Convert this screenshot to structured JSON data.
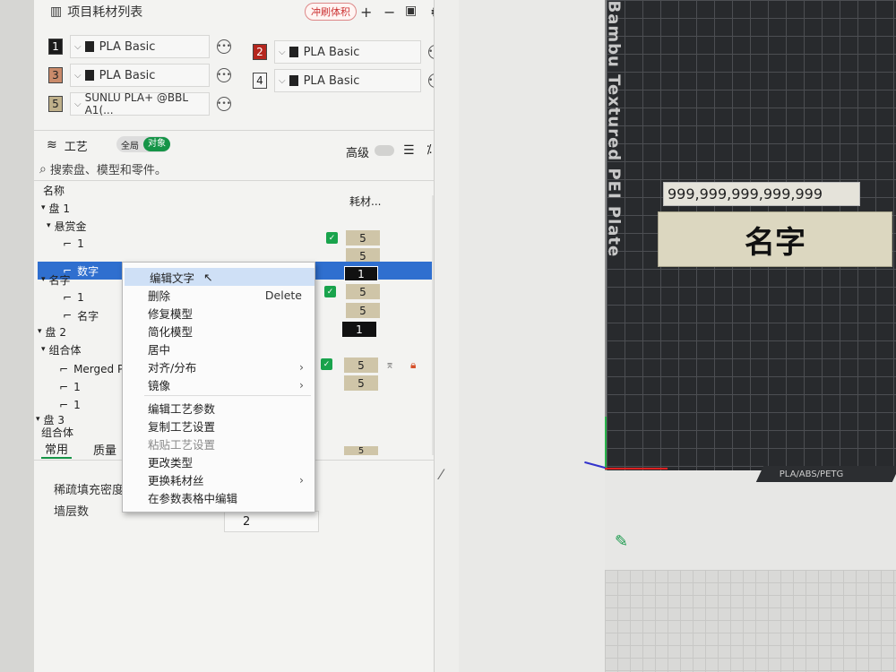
{
  "topbar": {
    "title": "项目耗材列表",
    "flush_button": "冲刷体积",
    "icons": [
      "plus-icon",
      "minus-icon",
      "sync-icon",
      "gear-icon"
    ]
  },
  "filaments": [
    {
      "num": "1",
      "name": "PLA Basic",
      "color": "#1a1a1a"
    },
    {
      "num": "2",
      "name": "PLA Basic",
      "color": "#b5261e"
    },
    {
      "num": "3",
      "name": "PLA Basic",
      "color": "#c98a6a"
    },
    {
      "num": "4",
      "name": "PLA Basic",
      "color": "#f5f5f5"
    },
    {
      "num": "5",
      "name": "SUNLU PLA+ @BBL A1(...",
      "color": "#bfb08a"
    }
  ],
  "process": {
    "label": "工艺",
    "toggle_global": "全局",
    "toggle_object": "对象",
    "advanced": "高级"
  },
  "search": {
    "placeholder": "搜索盘、模型和零件。"
  },
  "tree": {
    "col_name": "名称",
    "col_filament": "耗材...",
    "rows": [
      {
        "label": "盘 1",
        "indent": 0,
        "arrow": true
      },
      {
        "label": "悬赏金",
        "indent": 1,
        "arrow": true
      },
      {
        "label": "1",
        "indent": 2,
        "check": true,
        "filament": "5"
      },
      {
        "label": "数字",
        "indent": 2,
        "selected": true,
        "filament": "5"
      },
      {
        "label": "",
        "indent": 0,
        "filament": "1",
        "black": true
      },
      {
        "label": "名字",
        "indent": 1,
        "arrow": true,
        "check": true,
        "filament": "5"
      },
      {
        "label": "1",
        "indent": 2,
        "filament": "5"
      },
      {
        "label": "名字",
        "indent": 2,
        "filament": "1",
        "black": true
      },
      {
        "label": "盘 2",
        "indent": 0,
        "arrow": true
      },
      {
        "label": "组合体",
        "indent": 1,
        "arrow": true
      },
      {
        "label": "Merged P",
        "indent": 2,
        "check": true,
        "filament": "5"
      },
      {
        "label": "1",
        "indent": 2,
        "filament": "5"
      },
      {
        "label": "1",
        "indent": 2
      },
      {
        "label": "盘 3",
        "indent": 0,
        "arrow": true
      },
      {
        "label": "组合体",
        "indent": 1,
        "arrow": true,
        "check": true,
        "filament": "5"
      }
    ]
  },
  "tabs": {
    "common": "常用",
    "quality": "质量"
  },
  "params": {
    "infill_density": "稀疏填充密度",
    "wall_loops": "墙层数",
    "wall_loops_value": "2"
  },
  "context_menu": {
    "items": [
      {
        "label": "编辑文字",
        "highlight": true
      },
      {
        "label": "删除",
        "shortcut": "Delete"
      },
      {
        "label": "修复模型"
      },
      {
        "label": "简化模型"
      },
      {
        "label": "居中"
      },
      {
        "label": "对齐/分布",
        "submenu": true
      },
      {
        "label": "镜像",
        "submenu": true
      },
      {
        "label": "编辑工艺参数"
      },
      {
        "label": "复制工艺设置"
      },
      {
        "label": "粘贴工艺设置",
        "disabled": true
      },
      {
        "label": "更改类型"
      },
      {
        "label": "更换耗材丝",
        "submenu": true
      },
      {
        "label": "在参数表格中编辑"
      }
    ]
  },
  "viewport": {
    "plate_label": "Bambu Textured PEI Plate",
    "number_strip": "999,999,999,999,999",
    "name_card": "名字",
    "plate_tag": "PLA/ABS/PETG"
  }
}
